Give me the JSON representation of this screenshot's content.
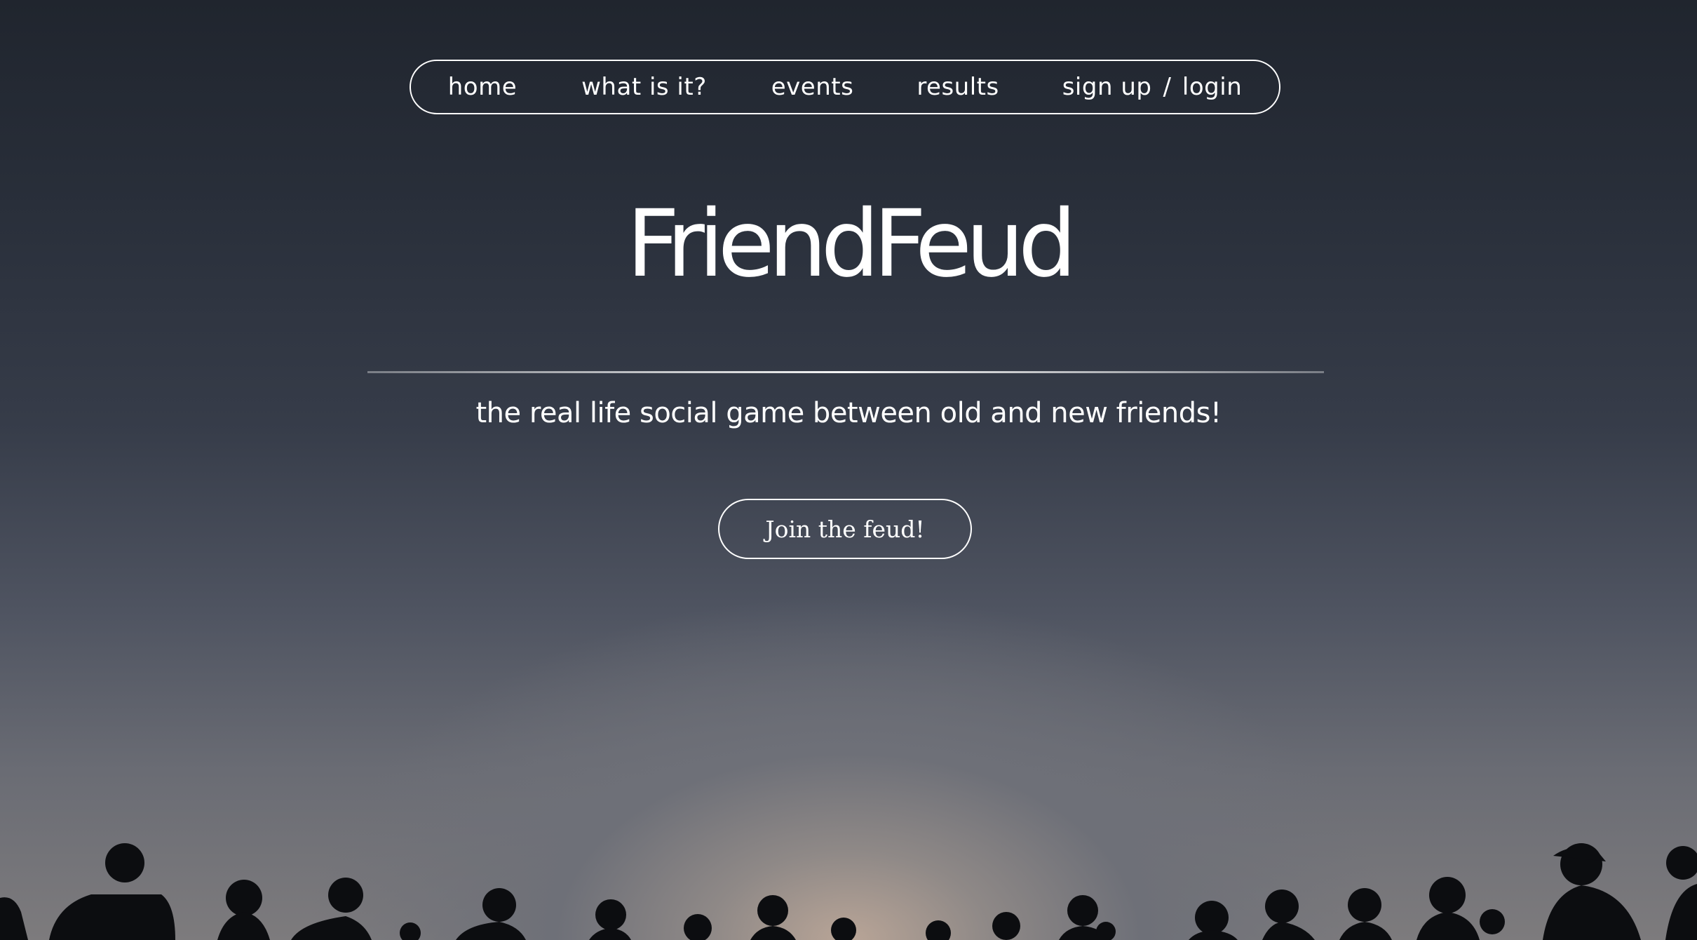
{
  "nav": {
    "home": "home",
    "what": "what is it?",
    "events": "events",
    "results": "results",
    "signup": "sign up",
    "separator": "/",
    "login": "login"
  },
  "hero": {
    "brand": "FriendFeud",
    "tagline": "the real life social game between old and new friends!",
    "cta_label": "Join the feud!"
  },
  "colors": {
    "text": "#ffffff",
    "sky_top": "#20252e",
    "sky_horizon": "#b9a597",
    "silhouette": "#0c0d10"
  }
}
